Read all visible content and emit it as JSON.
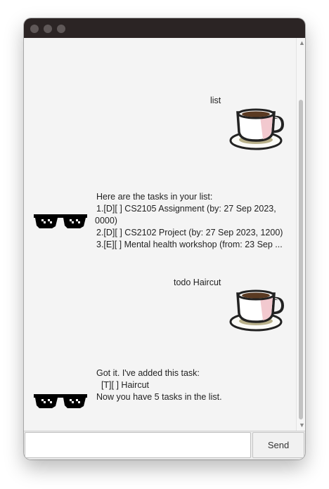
{
  "chat": {
    "messages": [
      {
        "sender": "user",
        "avatar": "coffee-cup-icon",
        "text": "list"
      },
      {
        "sender": "bot",
        "avatar": "pixel-sunglasses-icon",
        "lines": [
          "Here are the tasks in your list:",
          "1.[D][ ] CS2105 Assignment (by: 27 Sep 2023,",
          "0000)",
          "2.[D][ ] CS2102 Project (by: 27 Sep 2023, 1200)",
          "3.[E][ ] Mental health workshop (from: 23 Sep ..."
        ]
      },
      {
        "sender": "user",
        "avatar": "coffee-cup-icon",
        "text": "todo Haircut"
      },
      {
        "sender": "bot",
        "avatar": "pixel-sunglasses-icon",
        "lines": [
          "Got it. I've added this task:",
          "  [T][ ] Haircut",
          "Now you have 5 tasks in the list."
        ]
      }
    ]
  },
  "input": {
    "value": "",
    "placeholder": ""
  },
  "send_button": {
    "label": "Send"
  },
  "colors": {
    "titlebar": "#2b2424",
    "chat_bg": "#f4f4f4",
    "coffee": "#5a3a22",
    "cup_tint": "#f2c9cf"
  }
}
